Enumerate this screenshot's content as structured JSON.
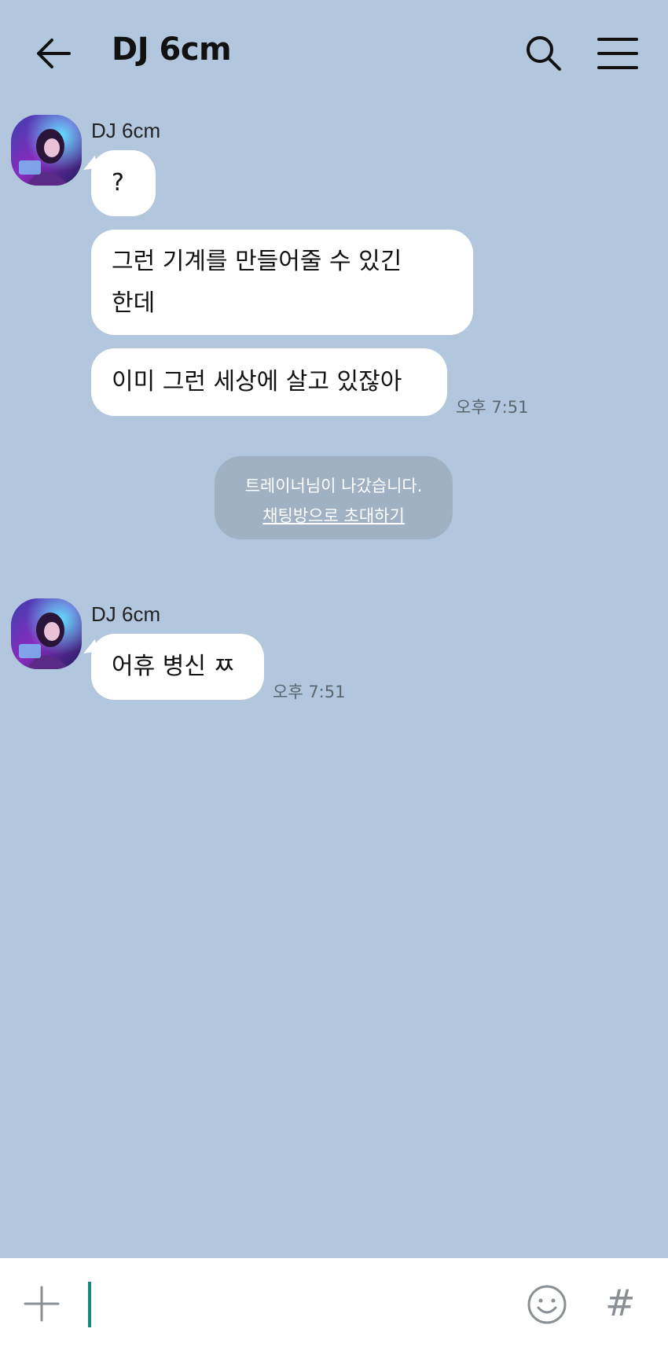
{
  "header": {
    "title": "DJ 6cm",
    "back_icon": "arrow-left-icon",
    "search_icon": "search-icon",
    "menu_icon": "hamburger-menu-icon"
  },
  "messages": [
    {
      "sender": "DJ 6cm",
      "bubbles": [
        "?",
        "그런 기계를 만들어줄 수 있긴\n한데",
        "이미 그런 세상에 살고 있잖아"
      ],
      "time": "오후 7:51"
    },
    {
      "sender": "DJ 6cm",
      "bubbles": [
        "어휴 병신 ㅉ"
      ],
      "time": "오후 7:51"
    }
  ],
  "notice": {
    "text": "트레이너님이 나갔습니다.",
    "link": "채팅방으로 초대하기"
  },
  "input_bar": {
    "plus_icon": "plus-icon",
    "emoji_icon": "smiley-icon",
    "hash_label": "#"
  },
  "colors": {
    "background": "#b2c7dd",
    "bubble": "#ffffff",
    "notice_bg": "#9fb1c2",
    "caret": "#1a8a7a"
  }
}
